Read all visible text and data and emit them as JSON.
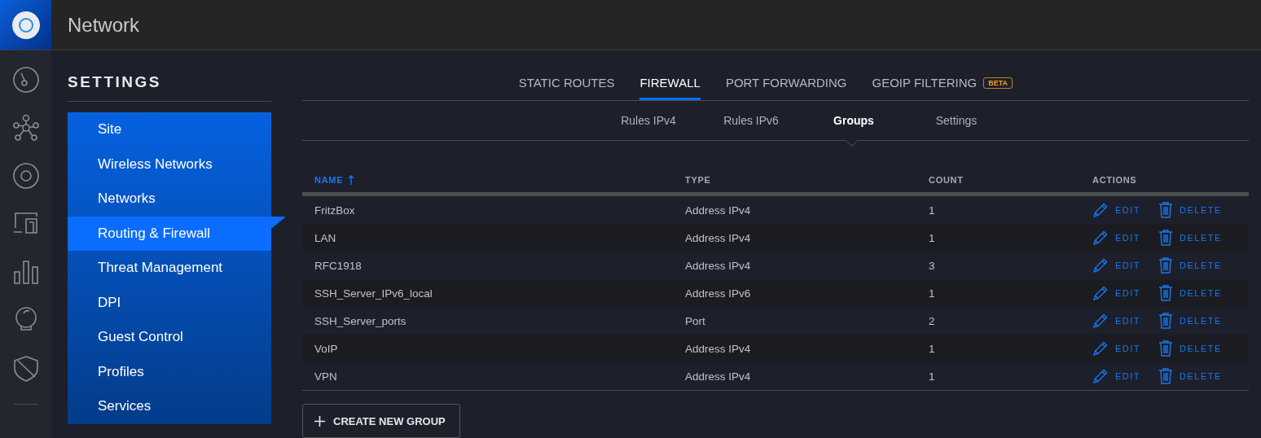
{
  "app": {
    "title": "Network"
  },
  "settings": {
    "title": "SETTINGS",
    "items": [
      {
        "label": "Site",
        "selected": false
      },
      {
        "label": "Wireless Networks",
        "selected": false
      },
      {
        "label": "Networks",
        "selected": false
      },
      {
        "label": "Routing & Firewall",
        "selected": true
      },
      {
        "label": "Threat Management",
        "selected": false
      },
      {
        "label": "DPI",
        "selected": false
      },
      {
        "label": "Guest Control",
        "selected": false
      },
      {
        "label": "Profiles",
        "selected": false
      },
      {
        "label": "Services",
        "selected": false
      }
    ]
  },
  "tabs": [
    {
      "label": "STATIC ROUTES",
      "selected": false
    },
    {
      "label": "FIREWALL",
      "selected": true
    },
    {
      "label": "PORT FORWARDING",
      "selected": false
    },
    {
      "label": "GEOIP FILTERING",
      "selected": false,
      "badge": "BETA"
    }
  ],
  "subtabs": [
    {
      "label": "Rules IPv4",
      "selected": false
    },
    {
      "label": "Rules IPv6",
      "selected": false
    },
    {
      "label": "Groups",
      "selected": true
    },
    {
      "label": "Settings",
      "selected": false
    }
  ],
  "table": {
    "columns": [
      {
        "label": "NAME",
        "sorted": true
      },
      {
        "label": "TYPE",
        "sorted": false
      },
      {
        "label": "COUNT",
        "sorted": false
      },
      {
        "label": "ACTIONS",
        "sorted": false
      }
    ],
    "rows": [
      {
        "name": "FritzBox",
        "type": "Address IPv4",
        "count": "1",
        "edit": "EDIT",
        "delete": "DELETE"
      },
      {
        "name": "LAN",
        "type": "Address IPv4",
        "count": "1",
        "edit": "EDIT",
        "delete": "DELETE"
      },
      {
        "name": "RFC1918",
        "type": "Address IPv4",
        "count": "3",
        "edit": "EDIT",
        "delete": "DELETE"
      },
      {
        "name": "SSH_Server_IPv6_local",
        "type": "Address IPv6",
        "count": "1",
        "edit": "EDIT",
        "delete": "DELETE"
      },
      {
        "name": "SSH_Server_ports",
        "type": "Port",
        "count": "2",
        "edit": "EDIT",
        "delete": "DELETE"
      },
      {
        "name": "VoIP",
        "type": "Address IPv4",
        "count": "1",
        "edit": "EDIT",
        "delete": "DELETE"
      },
      {
        "name": "VPN",
        "type": "Address IPv4",
        "count": "1",
        "edit": "EDIT",
        "delete": "DELETE"
      }
    ]
  },
  "create_button": "CREATE NEW GROUP"
}
